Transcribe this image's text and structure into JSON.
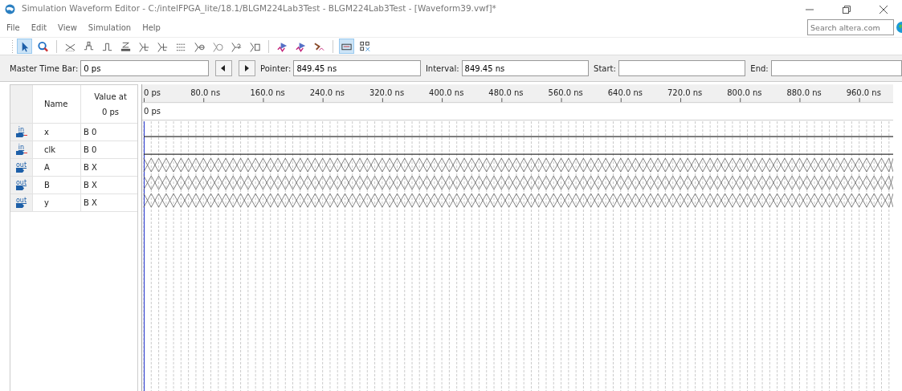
{
  "window": {
    "title": "Simulation Waveform Editor - C:/intelFPGA_lite/18.1/BLGM224Lab3Test - BLGM224Lab3Test - [Waveform39.vwf]*"
  },
  "menu": [
    "File",
    "Edit",
    "View",
    "Simulation",
    "Help"
  ],
  "search": {
    "placeholder": "Search altera.com"
  },
  "toolbar": [
    {
      "kind": "pointer",
      "selected": true
    },
    {
      "kind": "zoom",
      "selected": false
    },
    {
      "kind": "sep"
    },
    {
      "kind": "unknown",
      "selected": false
    },
    {
      "kind": "zero",
      "selected": false
    },
    {
      "kind": "one",
      "selected": false
    },
    {
      "kind": "highz",
      "selected": false
    },
    {
      "kind": "weak",
      "selected": false
    },
    {
      "kind": "weak",
      "selected": false
    },
    {
      "kind": "invert",
      "selected": false
    },
    {
      "kind": "count",
      "selected": false
    },
    {
      "kind": "clock",
      "selected": false
    },
    {
      "kind": "arbitrary",
      "selected": false
    },
    {
      "kind": "random",
      "selected": false
    },
    {
      "kind": "sep"
    },
    {
      "kind": "run",
      "selected": false
    },
    {
      "kind": "run",
      "selected": false
    },
    {
      "kind": "netlist",
      "selected": false
    },
    {
      "kind": "sep"
    },
    {
      "kind": "snap",
      "selected": true
    },
    {
      "kind": "grid",
      "selected": false
    }
  ],
  "time_bar": {
    "master_label": "Master Time Bar:",
    "master_value": "0 ps",
    "pointer_label": "Pointer:",
    "pointer_value": "849.45 ns",
    "interval_label": "Interval:",
    "interval_value": "849.45 ns",
    "start_label": "Start:",
    "end_label": "End:"
  },
  "columns": {
    "name": "Name",
    "value": "Value at",
    "value_time": "0 ps"
  },
  "ruler": {
    "ticks": [
      "0 ps",
      "80.0 ns",
      "160.0 ns",
      "240.0 ns",
      "320.0 ns",
      "400.0 ns",
      "480.0 ns",
      "560.0 ns",
      "640.0 ns",
      "720.0 ns",
      "800.0 ns",
      "880.0 ns",
      "960.0 ns"
    ],
    "cursor_label": "0 ps"
  },
  "signals": [
    {
      "direction": "in",
      "name": "x",
      "value": "B 0",
      "kind": "low"
    },
    {
      "direction": "in",
      "name": "clk",
      "value": "B 0",
      "kind": "low"
    },
    {
      "direction": "out",
      "name": "A",
      "value": "B X",
      "kind": "unknown"
    },
    {
      "direction": "out",
      "name": "B",
      "value": "B X",
      "kind": "unknown"
    },
    {
      "direction": "out",
      "name": "y",
      "value": "B X",
      "kind": "unknown"
    }
  ]
}
